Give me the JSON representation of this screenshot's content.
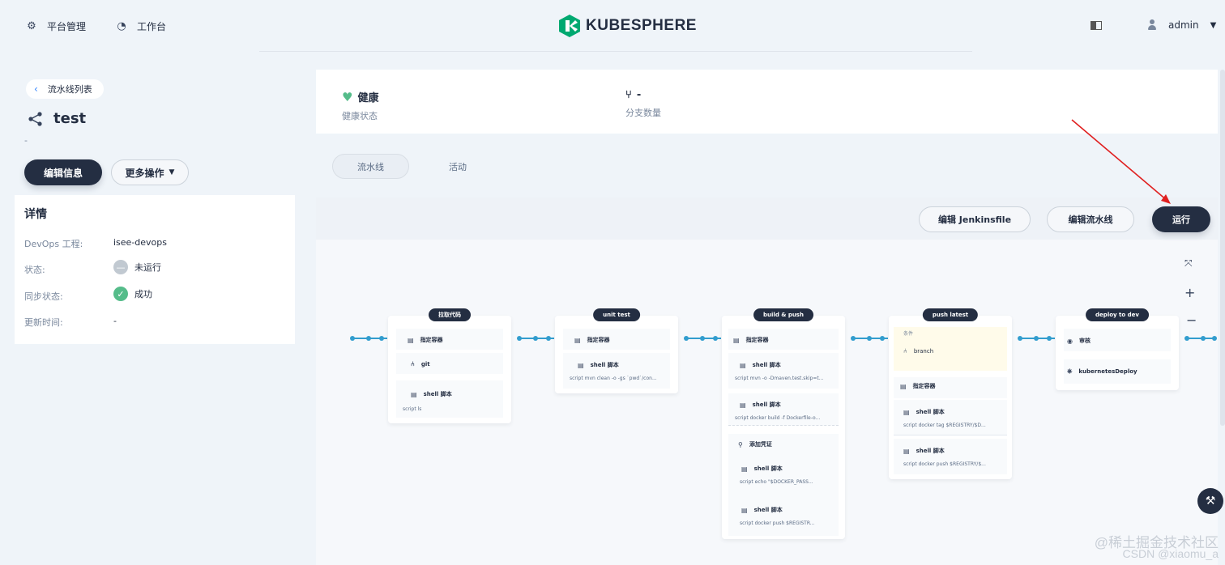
{
  "topbar": {
    "nav": [
      {
        "label": "平台管理",
        "icon": "gear-icon"
      },
      {
        "label": "工作台",
        "icon": "dashboard-icon"
      }
    ],
    "brand": "KUBESPHERE",
    "user": "admin"
  },
  "sidebar": {
    "back_label": "流水线列表",
    "pipeline_name": "test",
    "description": "-",
    "edit_button": "编辑信息",
    "more_button": "更多操作",
    "details_title": "详情",
    "details": [
      {
        "label": "DevOps 工程:",
        "value": "isee-devops"
      },
      {
        "label": "状态:",
        "value": "未运行",
        "status": "idle"
      },
      {
        "label": "同步状态:",
        "value": "成功",
        "status": "ok"
      },
      {
        "label": "更新时间:",
        "value": "-"
      }
    ]
  },
  "summary": {
    "health_value": "健康",
    "health_label": "健康状态",
    "branch_value": "-",
    "branch_label": "分支数量",
    "health_color": "#55bc8a"
  },
  "tabs": [
    {
      "label": "流水线",
      "active": true
    },
    {
      "label": "活动",
      "active": false
    }
  ],
  "toolbar": {
    "edit_jenkinsfile": "编辑 Jenkinsfile",
    "edit_pipeline": "编辑流水线",
    "run": "运行"
  },
  "stages": [
    {
      "name": "拉取代码",
      "steps": [
        {
          "title": "指定容器",
          "icon": "container-icon"
        },
        {
          "title": "git",
          "icon": "git-icon"
        },
        {
          "title": "shell 脚本",
          "icon": "terminal-icon",
          "script": "script   ls"
        }
      ]
    },
    {
      "name": "unit test",
      "steps": [
        {
          "title": "指定容器",
          "icon": "container-icon"
        },
        {
          "title": "shell 脚本",
          "icon": "terminal-icon",
          "script": "script   mvn clean -o -gs `pwd`/con..."
        }
      ]
    },
    {
      "name": "build & push",
      "steps": [
        {
          "title": "指定容器",
          "icon": "container-icon"
        },
        {
          "title": "shell 脚本",
          "icon": "terminal-icon",
          "script": "script   mvn -o -Dmaven.test.skip=t..."
        },
        {
          "title": "shell 脚本",
          "icon": "terminal-icon",
          "script": "script   docker build -f Dockerfile-o..."
        },
        {
          "title": "添加凭证",
          "icon": "key-icon"
        },
        {
          "title": "shell 脚本",
          "icon": "terminal-icon",
          "script": "script   echo \"$DOCKER_PASS..."
        },
        {
          "title": "shell 脚本",
          "icon": "terminal-icon",
          "script": "script   docker push $REGISTR..."
        }
      ]
    },
    {
      "name": "push latest",
      "condition_label": "条件",
      "steps": [
        {
          "title": "branch",
          "icon": "branch-icon"
        },
        {
          "title": "指定容器",
          "icon": "container-icon"
        },
        {
          "title": "shell 脚本",
          "icon": "terminal-icon",
          "script": "script   docker tag $REGISTRY/$D..."
        },
        {
          "title": "shell 脚本",
          "icon": "terminal-icon",
          "script": "script   docker push $REGISTRY/$..."
        }
      ]
    },
    {
      "name": "deploy to dev",
      "steps": [
        {
          "title": "审核",
          "icon": "audit-icon"
        },
        {
          "title": "kubernetesDeploy",
          "icon": "kubernetes-icon"
        }
      ]
    }
  ],
  "watermark": {
    "line1": "@稀土掘金技术社区",
    "line2": "CSDN @xiaomu_a"
  }
}
